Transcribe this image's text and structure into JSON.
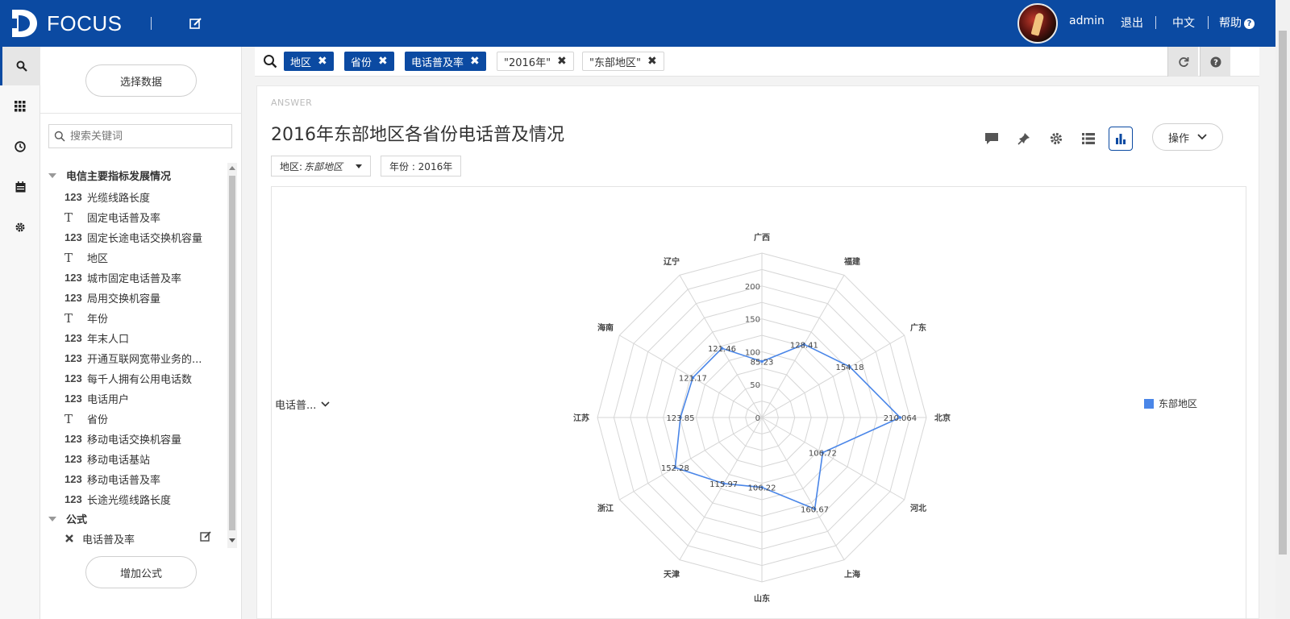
{
  "header": {
    "brand": "FOCUS",
    "user": "admin",
    "logout": "退出",
    "language": "中文",
    "help": "帮助",
    "help_icon": "?"
  },
  "rail": {
    "items": [
      "search-icon",
      "apps-grid-icon",
      "history-icon",
      "calendar-icon",
      "settings-icon"
    ],
    "active": "search-icon"
  },
  "datapanel": {
    "select_data": "选择数据",
    "search_placeholder": "搜索关键词",
    "group_title": "电信主要指标发展情况",
    "fields": [
      {
        "type": "123",
        "name": "光缆线路长度"
      },
      {
        "type": "T",
        "name": "固定电话普及率"
      },
      {
        "type": "123",
        "name": "固定长途电话交换机容量"
      },
      {
        "type": "T",
        "name": "地区"
      },
      {
        "type": "123",
        "name": "城市固定电话普及率"
      },
      {
        "type": "123",
        "name": "局用交换机容量"
      },
      {
        "type": "T",
        "name": "年份"
      },
      {
        "type": "123",
        "name": "年末人口"
      },
      {
        "type": "123",
        "name": "开通互联网宽带业务的..."
      },
      {
        "type": "123",
        "name": "每千人拥有公用电话数"
      },
      {
        "type": "123",
        "name": "电话用户"
      },
      {
        "type": "T",
        "name": "省份"
      },
      {
        "type": "123",
        "name": "移动电话交换机容量"
      },
      {
        "type": "123",
        "name": "移动电话基站"
      },
      {
        "type": "123",
        "name": "移动电话普及率"
      },
      {
        "type": "123",
        "name": "长途光缆线路长度"
      }
    ],
    "type_labels": {
      "num": "123",
      "text": "T"
    },
    "formula_group": "公式",
    "formula_item": "电话普及率",
    "add_formula": "增加公式"
  },
  "query": {
    "tokens": [
      {
        "label": "地区",
        "style": "blue"
      },
      {
        "label": "省份",
        "style": "blue"
      },
      {
        "label": "电话普及率",
        "style": "blue"
      },
      {
        "label": "\"2016年\"",
        "style": "plain"
      },
      {
        "label": "\"东部地区\"",
        "style": "plain"
      }
    ]
  },
  "answer": {
    "label": "ANSWER",
    "title": "2016年东部地区各省份电话普及情况",
    "filter_region_label": "地区: ",
    "filter_region_value": "东部地区",
    "filter_year": "年份 : 2016年",
    "ops": "操作",
    "measure": "电话普...",
    "toolbar": [
      "comment-icon",
      "pin-icon",
      "gear-icon",
      "table-icon",
      "bar-chart-icon"
    ]
  },
  "colors": {
    "brand": "#0b4aa2",
    "series": "#4a86e8"
  },
  "chart_data": {
    "type": "radar",
    "categories": [
      "广西",
      "福建",
      "广东",
      "北京",
      "河北",
      "上海",
      "山东",
      "天津",
      "浙江",
      "江苏",
      "海南",
      "辽宁"
    ],
    "series": [
      {
        "name": "东部地区",
        "values": [
          85.23,
          128.41,
          154.18,
          210.064,
          106.72,
          160.67,
          106.22,
          115.97,
          152.28,
          123.85,
          121.17,
          121.46
        ]
      }
    ],
    "value_labels": [
      "85.23",
      "128.41",
      "154.18",
      "210.064",
      "106.72",
      "160.67",
      "106.22",
      "115.97",
      "152.28",
      "123.85",
      "121.17",
      "121.46"
    ],
    "radial_ticks": [
      "0",
      "50",
      "100",
      "150",
      "200"
    ],
    "rmax": 250,
    "legend": "right",
    "grid": true
  }
}
